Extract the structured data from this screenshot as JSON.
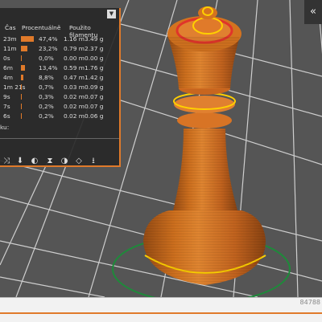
{
  "legend": {
    "headers": {
      "time": "Čas",
      "percent": "Procentuálně",
      "filament": "Použito filamentu"
    },
    "rows": [
      {
        "time": "23m",
        "percent": "47,4%",
        "length": "1.16 m",
        "weight": "3.49 g",
        "bar": 0.474
      },
      {
        "time": "11m",
        "percent": "23,2%",
        "length": "0.79 m",
        "weight": "2.37 g",
        "bar": 0.232
      },
      {
        "time": "0s",
        "percent": "0,0%",
        "length": "0.00 m",
        "weight": "0.00 g",
        "bar": 0.0
      },
      {
        "time": "6m",
        "percent": "13,4%",
        "length": "0.59 m",
        "weight": "1.76 g",
        "bar": 0.134
      },
      {
        "time": "4m",
        "percent": "8,8%",
        "length": "0.47 m",
        "weight": "1.42 g",
        "bar": 0.088
      },
      {
        "time": "1m 21s",
        "percent": "0,7%",
        "length": "0.03 m",
        "weight": "0.09 g",
        "bar": 0.007
      },
      {
        "time": "9s",
        "percent": "0,3%",
        "length": "0.02 m",
        "weight": "0.07 g",
        "bar": 0.003
      },
      {
        "time": "7s",
        "percent": "0,2%",
        "length": "0.02 m",
        "weight": "0.07 g",
        "bar": 0.002
      },
      {
        "time": "6s",
        "percent": "0,2%",
        "length": "0.02 m",
        "weight": "0.06 g",
        "bar": 0.002
      }
    ],
    "extra_label": "ku:",
    "toolbar_icons": [
      "travel-icon",
      "retraction-icon",
      "color-icon",
      "hourglass-icon",
      "seam-icon",
      "shell-icon",
      "download-icon"
    ]
  },
  "collapse_icon": "«",
  "bottom_value": "84788",
  "colors": {
    "accent": "#e07a2a",
    "model": "#c8661f",
    "ring": "#ffd000",
    "bed": "#5a5a5a",
    "grid": "#d9d9d9"
  }
}
